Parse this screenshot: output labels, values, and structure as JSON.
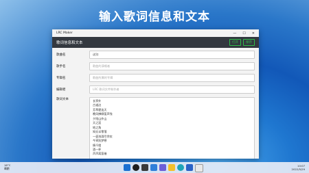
{
  "headline": "输入歌词信息和文本",
  "window": {
    "title": "LRC Maker",
    "controls": [
      "—",
      "☐",
      "✕"
    ]
  },
  "app": {
    "header_title": "歌词信息和文本",
    "buttons": [
      "打开",
      "保存"
    ]
  },
  "form": {
    "song_label": "歌曲名",
    "song_value": "送别",
    "singer_label": "歌手名",
    "singer_placeholder": "歌曲的演唱者",
    "album_label": "专辑名",
    "album_placeholder": "歌曲所属的专辑",
    "editor_label": "编辑者",
    "editor_placeholder": "LRC 歌词文件制作者",
    "lyrics_label": "歌词文本",
    "lyrics_lines": [
      "长亭外",
      "古道边",
      "芳草碧连天",
      "晚风拂柳笛声残",
      "夕阳山外山",
      "天之涯",
      "地之角",
      "知交半零落",
      "一壶浊酒尽余欢",
      "今宵别梦寒",
      "情千缕",
      "酒一杯",
      "声声离笛催"
    ]
  },
  "taskbar": {
    "weather_temp": "16°C",
    "weather_desc": "晴朗",
    "time": "10:07",
    "date": "2022/5/29"
  },
  "colors": {
    "header_bg": "#33383f",
    "accent_green": "#2fbf4a"
  }
}
